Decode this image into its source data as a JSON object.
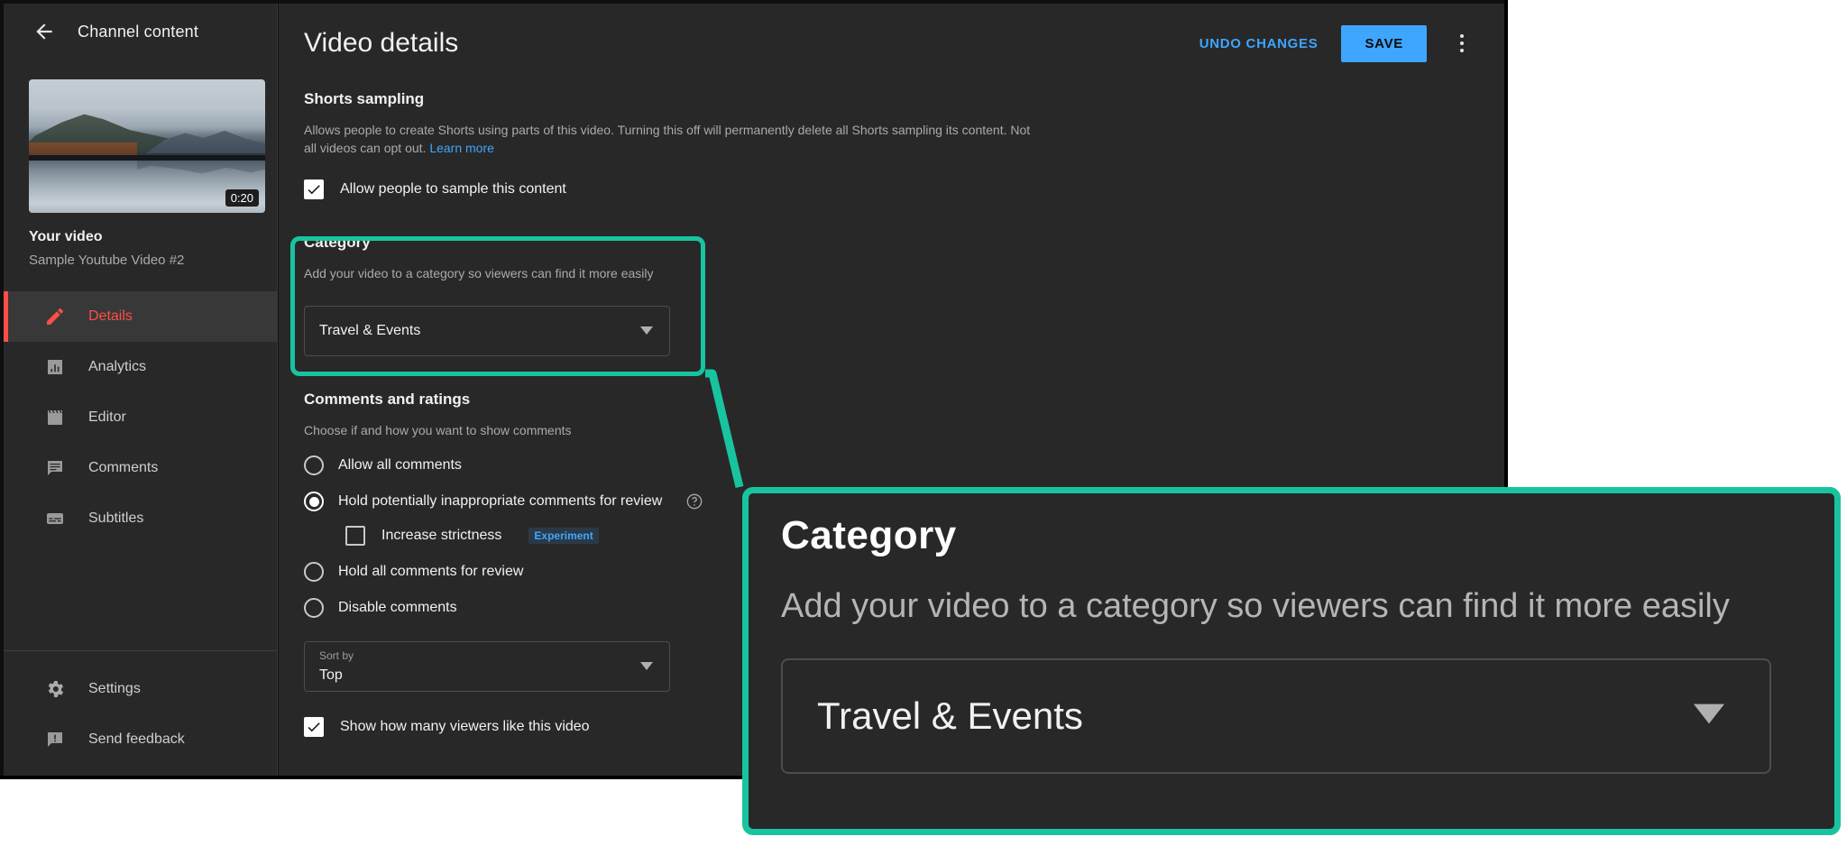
{
  "sidebar": {
    "back_icon": "back-arrow-icon",
    "title": "Channel content",
    "thumbnail": {
      "duration": "0:20"
    },
    "video": {
      "label": "Your video",
      "name": "Sample Youtube Video #2"
    },
    "nav_items": [
      {
        "label": "Details",
        "icon": "pencil-icon",
        "active": true
      },
      {
        "label": "Analytics",
        "icon": "bar-chart-icon",
        "active": false
      },
      {
        "label": "Editor",
        "icon": "clapperboard-icon",
        "active": false
      },
      {
        "label": "Comments",
        "icon": "comment-icon",
        "active": false
      },
      {
        "label": "Subtitles",
        "icon": "subtitles-icon",
        "active": false
      }
    ],
    "bottom_items": [
      {
        "label": "Settings",
        "icon": "gear-icon"
      },
      {
        "label": "Send feedback",
        "icon": "feedback-icon"
      }
    ]
  },
  "header": {
    "title": "Video details",
    "undo_label": "UNDO CHANGES",
    "save_label": "SAVE",
    "menu_icon": "kebab-menu-icon"
  },
  "shorts": {
    "title": "Shorts sampling",
    "description": "Allows people to create Shorts using parts of this video. Turning this off will permanently delete all Shorts sampling its content. Not all videos can opt out.",
    "learn_more": "Learn more",
    "checkbox_label": "Allow people to sample this content",
    "checkbox_checked": true
  },
  "category": {
    "title": "Category",
    "description": "Add your video to a category so viewers can find it more easily",
    "selected": "Travel & Events",
    "caret_icon": "chevron-down-icon"
  },
  "comments": {
    "title": "Comments and ratings",
    "description": "Choose if and how you want to show comments",
    "options": [
      {
        "label": "Allow all comments",
        "selected": false
      },
      {
        "label": "Hold potentially inappropriate comments for review",
        "selected": true
      },
      {
        "label": "Hold all comments for review",
        "selected": false
      },
      {
        "label": "Disable comments",
        "selected": false
      }
    ],
    "strictness": {
      "label": "Increase strictness",
      "badge": "Experiment",
      "checked": false
    },
    "help_icon": "help-circle-icon",
    "sort": {
      "float_label": "Sort by",
      "value": "Top"
    },
    "show_likes": {
      "label": "Show how many viewers like this video",
      "checked": true
    }
  },
  "callout": {
    "title": "Category",
    "description": "Add your video to a category so viewers can find it more easily",
    "selected": "Travel & Events",
    "caret_icon": "chevron-down-icon"
  },
  "colors": {
    "highlight": "#18c4a0",
    "accent_red": "#ff4e45",
    "accent_blue": "#3ea6ff",
    "panel_bg": "#282828",
    "window_bg": "#0f0f0f"
  }
}
